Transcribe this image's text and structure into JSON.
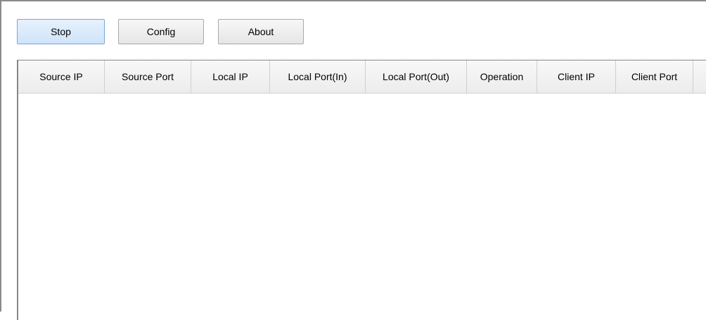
{
  "toolbar": {
    "stop_label": "Stop",
    "config_label": "Config",
    "about_label": "About"
  },
  "table": {
    "columns": [
      "Source IP",
      "Source Port",
      "Local IP",
      "Local Port(In)",
      "Local Port(Out)",
      "Operation",
      "Client IP",
      "Client Port"
    ],
    "rows": []
  },
  "colors": {
    "primary_button": "#cfe4fa",
    "frame_border": "#828790"
  }
}
